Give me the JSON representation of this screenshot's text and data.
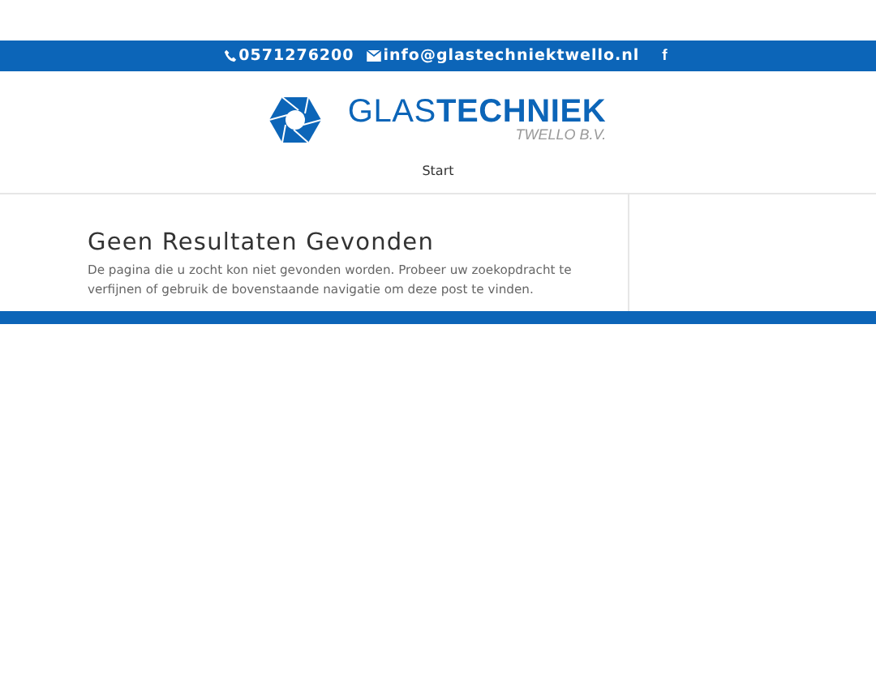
{
  "top_bar": {
    "phone": "0571276200",
    "email": "info@glastechniektwello.nl",
    "social": "f"
  },
  "logo": {
    "name": "GLAS**TECHNIEK**",
    "subtitle": "TWELLO B.V."
  },
  "nav": [
    {
      "label": "Start"
    }
  ],
  "content": {
    "title": "Geen Resultaten Gevonden",
    "text": "De pagina die u zocht kon niet gevonden worden. Probeer uw zoekopdracht te verfijnen of gebruik de bovenstaande navigatie om deze post te vinden."
  }
}
